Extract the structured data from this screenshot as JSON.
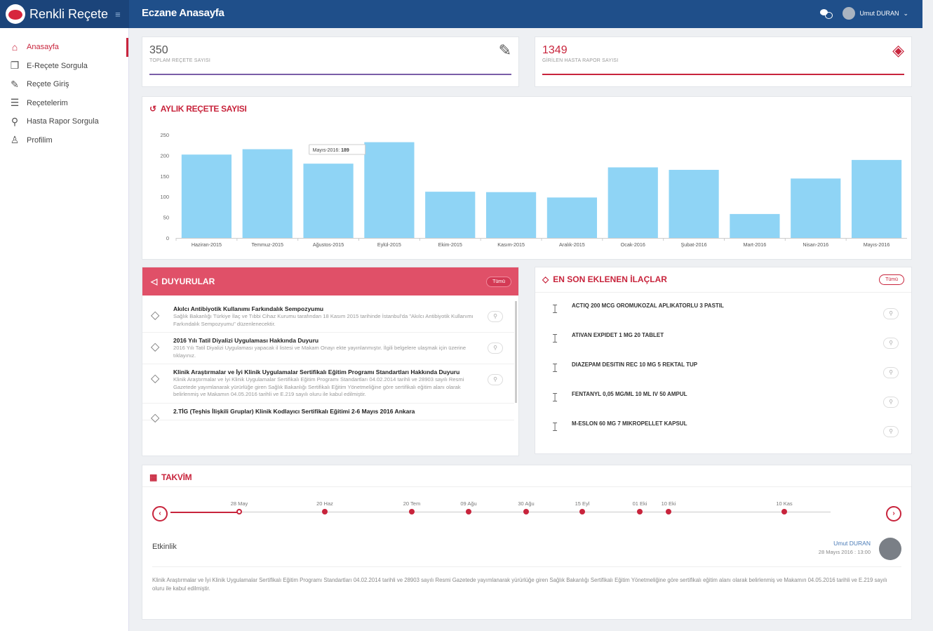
{
  "app": {
    "name": "Renkli Reçete",
    "page_title": "Eczane Anasayfa",
    "user_name": "Umut DURAN"
  },
  "sidebar": {
    "items": [
      {
        "label": "Anasayfa",
        "icon": "home-icon"
      },
      {
        "label": "E-Reçete Sorgula",
        "icon": "copy-icon"
      },
      {
        "label": "Reçete Giriş",
        "icon": "edit-icon"
      },
      {
        "label": "Reçetelerim",
        "icon": "list-icon"
      },
      {
        "label": "Hasta Rapor Sorgula",
        "icon": "search-icon"
      },
      {
        "label": "Profilim",
        "icon": "user-icon"
      }
    ]
  },
  "stats": [
    {
      "value": "350",
      "label": "TOPLAM REÇETE SAYISI",
      "color": "#7a5ea8"
    },
    {
      "value": "1349",
      "label": "GİRİLEN HASTA RAPOR SAYISI",
      "color": "#c8243c"
    }
  ],
  "chart": {
    "title": "AYLIK REÇETE SAYISI",
    "tooltip_label": "Mayıs-2016:",
    "tooltip_value": "189"
  },
  "chart_data": {
    "type": "bar",
    "categories": [
      "Haziran-2015",
      "Temmuz-2015",
      "Ağustos-2015",
      "Eylül-2015",
      "Ekim-2015",
      "Kasım-2015",
      "Aralık-2015",
      "Ocak-2016",
      "Şubat-2016",
      "Mart-2016",
      "Nisan-2016",
      "Mayıs-2016"
    ],
    "values": [
      202,
      215,
      180,
      232,
      112,
      111,
      98,
      171,
      165,
      58,
      144,
      189
    ],
    "ylim": [
      0,
      250
    ],
    "yticks": [
      0,
      50,
      100,
      150,
      200,
      250
    ],
    "color": "#8fd4f5"
  },
  "duyurular": {
    "title": "DUYURULAR",
    "all_label": "Tümü",
    "items": [
      {
        "head": "Akılcı Antibiyotik Kullanımı Farkındalık Sempozyumu",
        "text": "Sağlık Bakanlığı Türkiye İlaç ve Tıbbi Cihaz Kurumu tarafından 18 Kasım 2015 tarihinde İstanbul'da \"Akılcı Antibiyotik Kullanımı Farkındalık Sempozyumu\" düzenlenecektir."
      },
      {
        "head": "2016 Yılı Tatil Diyalizi Uygulaması Hakkında Duyuru",
        "text": "2016 Yılı Tatil Diyalizi Uygulaması yapacak il listesi ve Makam Onayı ekte yayınlanmıştır. İlgili belgelere ulaşmak için üzerine tıklayınız."
      },
      {
        "head": "Klinik Araştırmalar ve İyi Klinik Uygulamalar Sertifikalı Eğitim Programı Standartları Hakkında Duyuru",
        "text": "Klinik Araştırmalar ve İyi Klinik Uygulamalar Sertifikalı Eğitim Programı Standartları 04.02.2014 tarihli ve 28903 sayılı Resmi Gazetede yayımlanarak yürürlüğe giren Sağlık Bakanlığı Sertifikalı Eğitim Yönetmeliğine göre sertifikalı eğitim alanı olarak belirlenmiş ve Makamın 04.05.2016 tarihli ve E.219 sayılı oluru ile kabul edilmiştir."
      },
      {
        "head": "2.TİG (Teşhis İlişkili Gruplar) Klinik Kodlayıcı Sertifikalı Eğitimi 2-6 Mayıs 2016 Ankara",
        "text": ""
      }
    ]
  },
  "ilaclar": {
    "title": "EN SON EKLENEN İLAÇLAR",
    "all_label": "Tümü",
    "items": [
      "ACTIQ 200 MCG OROMUKOZAL APLIKATORLU 3 PASTIL",
      "ATIVAN EXPIDET 1 MG 20 TABLET",
      "DIAZEPAM DESITIN REC 10 MG 5 REKTAL TUP",
      "FENTANYL 0,05 MG/ML 10 ML IV 50 AMPUL",
      "M-ESLON 60 MG 7 MIKROPELLET KAPSUL"
    ]
  },
  "takvim": {
    "title": "TAKVİM",
    "dates": [
      "28 May",
      "20 Haz",
      "20 Tem",
      "09 Ağu",
      "30 Ağu",
      "15 Eyl",
      "01 Eki",
      "10 Eki",
      "10 Kas"
    ],
    "event_title": "Etkinlik",
    "event_author": "Umut DURAN",
    "event_date": "28 Mayıs 2016 : 13:00",
    "event_text": "Klinik Araştırmalar ve İyi Klinik Uygulamalar Sertifikalı Eğitim Programı Standartları 04.02.2014 tarihli ve 28903 sayılı Resmi Gazetede yayımlanarak yürürlüğe giren Sağlık Bakanlığı Sertifikalı Eğitim Yönetmeliğine göre sertifikalı eğitim alanı olarak belirlenmiş ve Makamın 04.05.2016 tarihli ve E.219 sayılı oluru ile kabul edilmiştir."
  }
}
